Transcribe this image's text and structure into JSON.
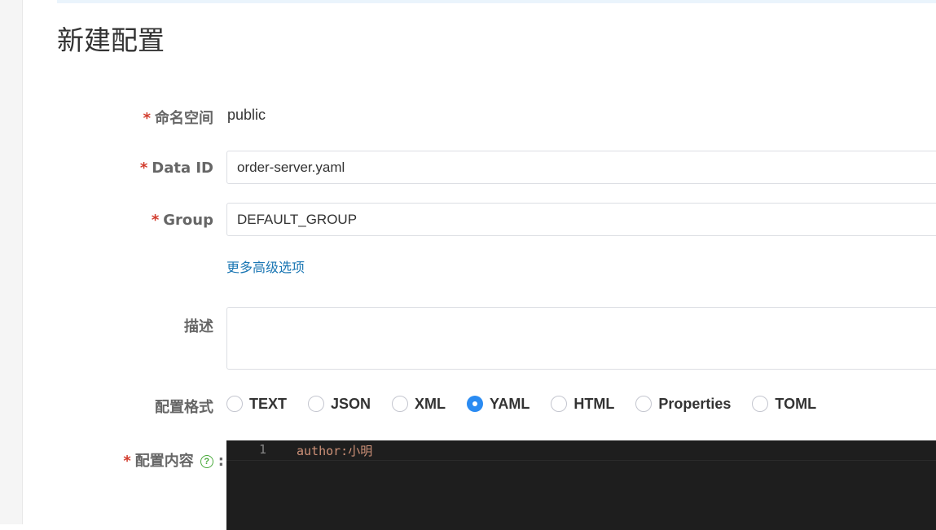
{
  "page": {
    "title": "新建配置"
  },
  "form": {
    "namespace": {
      "required": "*",
      "label": "命名空间",
      "value": "public"
    },
    "data_id": {
      "required": "*",
      "label": "Data ID",
      "value": "order-server.yaml"
    },
    "group": {
      "required": "*",
      "label": "Group",
      "value": "DEFAULT_GROUP"
    },
    "more_options_link": "更多高级选项",
    "description": {
      "label": "描述",
      "value": ""
    },
    "format": {
      "label": "配置格式",
      "options": [
        "TEXT",
        "JSON",
        "XML",
        "YAML",
        "HTML",
        "Properties",
        "TOML"
      ],
      "selected": "YAML"
    },
    "content": {
      "required": "*",
      "label": "配置内容",
      "help_icon": "?",
      "colon": ":",
      "lines": [
        {
          "number": "1",
          "text": "author:小明"
        }
      ]
    }
  },
  "colors": {
    "required": "#d23c2d",
    "link": "#1a76b3",
    "radio_selected": "#2a8bf2",
    "help_icon": "#4aaa3c",
    "editor_bg": "#1e1e1e",
    "code_text": "#ce9178"
  }
}
